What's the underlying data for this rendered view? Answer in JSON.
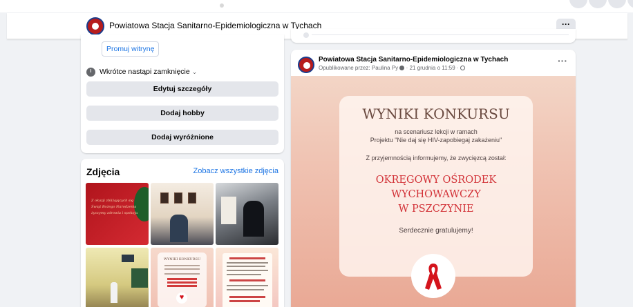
{
  "page": {
    "name": "Powiatowa Stacja Sanitarno-Epidemiologiczna w Tychach",
    "more_label": "···"
  },
  "about": {
    "promote_label": "Promuj witrynę",
    "closing_label": "Wkrótce nastąpi zamknięcie",
    "edit_label": "Edytuj szczegóły",
    "hobby_label": "Dodaj hobby",
    "featured_label": "Dodaj wyróżnione"
  },
  "photos": {
    "title": "Zdjęcia",
    "see_all": "Zobacz wszystkie zdjęcia",
    "thumb1_text": "Z okazji zbliżających się Świąt Bożego Narodzenia życzymy zdrowia i spokoju"
  },
  "post": {
    "author": "Powiatowa Stacja Sanitarno-Epidemiologiczna w Tychach",
    "published_by": "Opublikowane przez: Paulina Py",
    "date": "· 21 grudnia o 11:59 ·",
    "menu_label": "···",
    "image": {
      "headline": "WYNIKI KONKURSU",
      "line1": "na scenariusz lekcji w ramach",
      "line2": "Projektu \"Nie daj się HIV-zapobiegaj zakażeniu\"",
      "line3": "Z przyjemnością informujemy, że zwycięzcą został:",
      "winner1": "OKRĘGOWY OŚRODEK",
      "winner2": "WYCHOWAWCZY",
      "winner3": "W PSZCZYNIE",
      "congrats": "Serdecznie gratulujemy!"
    }
  },
  "colors": {
    "accent": "#1b74e4",
    "winner_red": "#d23238",
    "ribbon_red": "#d4141c"
  }
}
